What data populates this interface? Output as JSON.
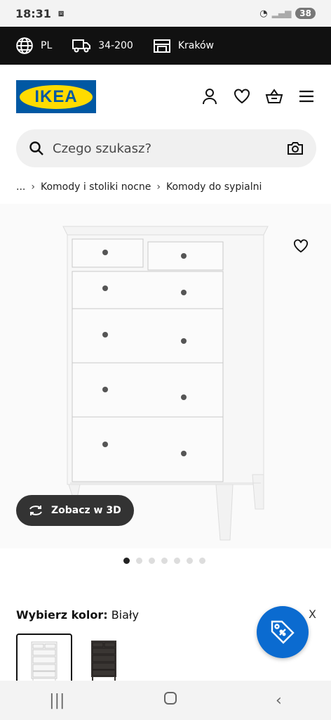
{
  "status": {
    "time": "18:31",
    "battery": "38"
  },
  "topbar": {
    "lang": "PL",
    "postcode": "34-200",
    "store": "Kraków"
  },
  "brand": {
    "logo_text": "IKEA",
    "logo_blue": "#0058a3",
    "logo_yellow": "#ffdb00"
  },
  "search": {
    "placeholder": "Czego szukasz?"
  },
  "breadcrumb": {
    "ellipsis": "...",
    "items": [
      "Komody i stoliki nocne",
      "Komody do sypialni"
    ]
  },
  "product": {
    "view3d_label": "Zobacz w 3D",
    "gallery_total": 7,
    "gallery_active": 1
  },
  "color": {
    "label": "Wybierz kolor:",
    "value": "Biały"
  },
  "fab": {
    "close": "X"
  },
  "icons": [
    "globe-icon",
    "truck-icon",
    "store-icon",
    "user-icon",
    "heart-icon",
    "basket-icon",
    "menu-icon",
    "search-icon",
    "camera-icon",
    "rotate-icon",
    "tag-icon"
  ]
}
